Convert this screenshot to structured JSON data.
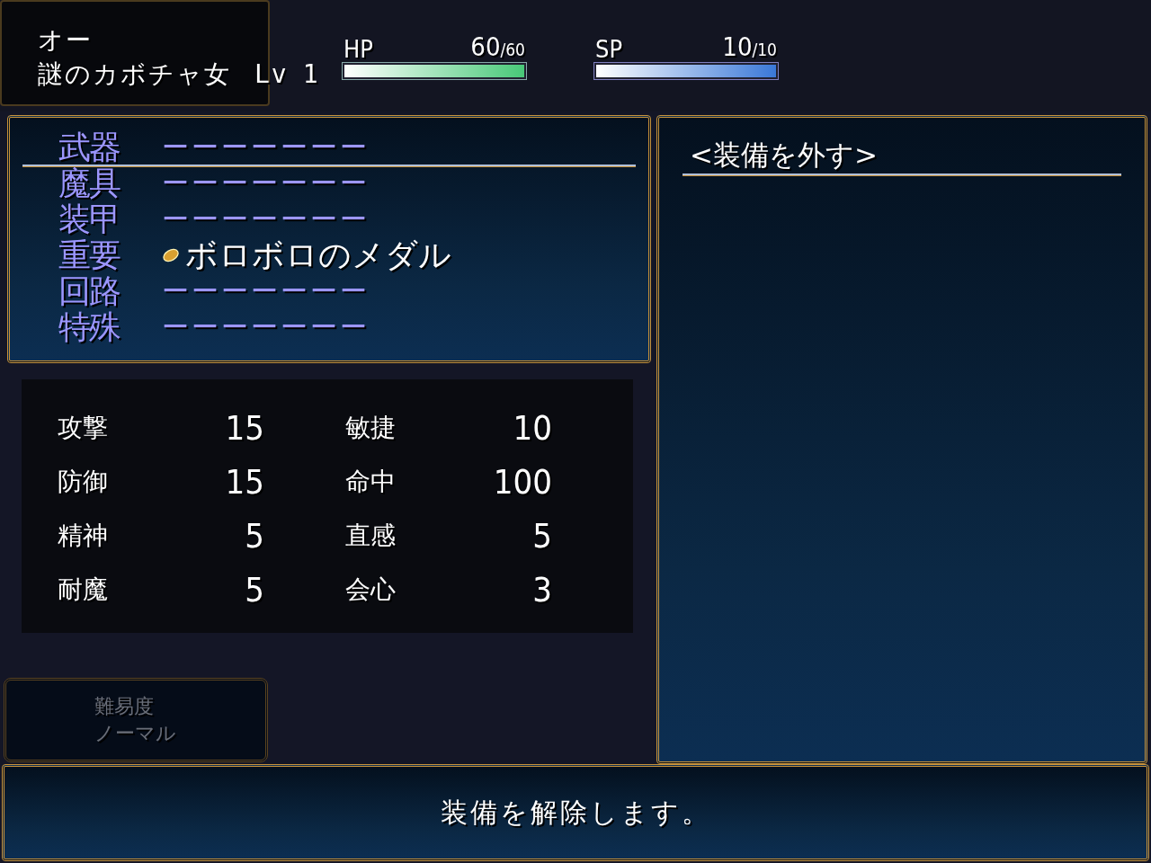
{
  "actor": {
    "title": "オー",
    "name": "謎のカボチャ女",
    "level_label": "Lv",
    "level": "1"
  },
  "gauges": [
    {
      "kind": "hp",
      "label": "HP",
      "value": "60",
      "max": "/60",
      "level": 1
    },
    {
      "kind": "sp",
      "label": "SP",
      "value": "10",
      "max": "/10",
      "level": 1
    }
  ],
  "slots": [
    {
      "label": "武器",
      "item": "ーーーーーーー",
      "empty": true,
      "selected": true
    },
    {
      "label": "魔具",
      "item": "ーーーーーーー",
      "empty": true,
      "selected": false
    },
    {
      "label": "装甲",
      "item": "ーーーーーーー",
      "empty": true,
      "selected": false
    },
    {
      "label": "重要",
      "item": "ボロボロのメダル",
      "empty": false,
      "selected": false
    },
    {
      "label": "回路",
      "item": "ーーーーーーー",
      "empty": true,
      "selected": false
    },
    {
      "label": "特殊",
      "item": "ーーーーーーー",
      "empty": true,
      "selected": false
    }
  ],
  "stats": [
    {
      "label": "攻撃",
      "value": "15"
    },
    {
      "label": "敏捷",
      "value": "10"
    },
    {
      "label": "防御",
      "value": "15"
    },
    {
      "label": "命中",
      "value": "100"
    },
    {
      "label": "精神",
      "value": "5"
    },
    {
      "label": "直感",
      "value": "5"
    },
    {
      "label": "耐魔",
      "value": "5"
    },
    {
      "label": "会心",
      "value": "3"
    }
  ],
  "difficulty": {
    "title": "難易度",
    "value": "ノーマル",
    "disabled": true
  },
  "item_list": [
    {
      "label": "<装備を外す>",
      "selected": true
    }
  ],
  "help": "装備を解除します。"
}
